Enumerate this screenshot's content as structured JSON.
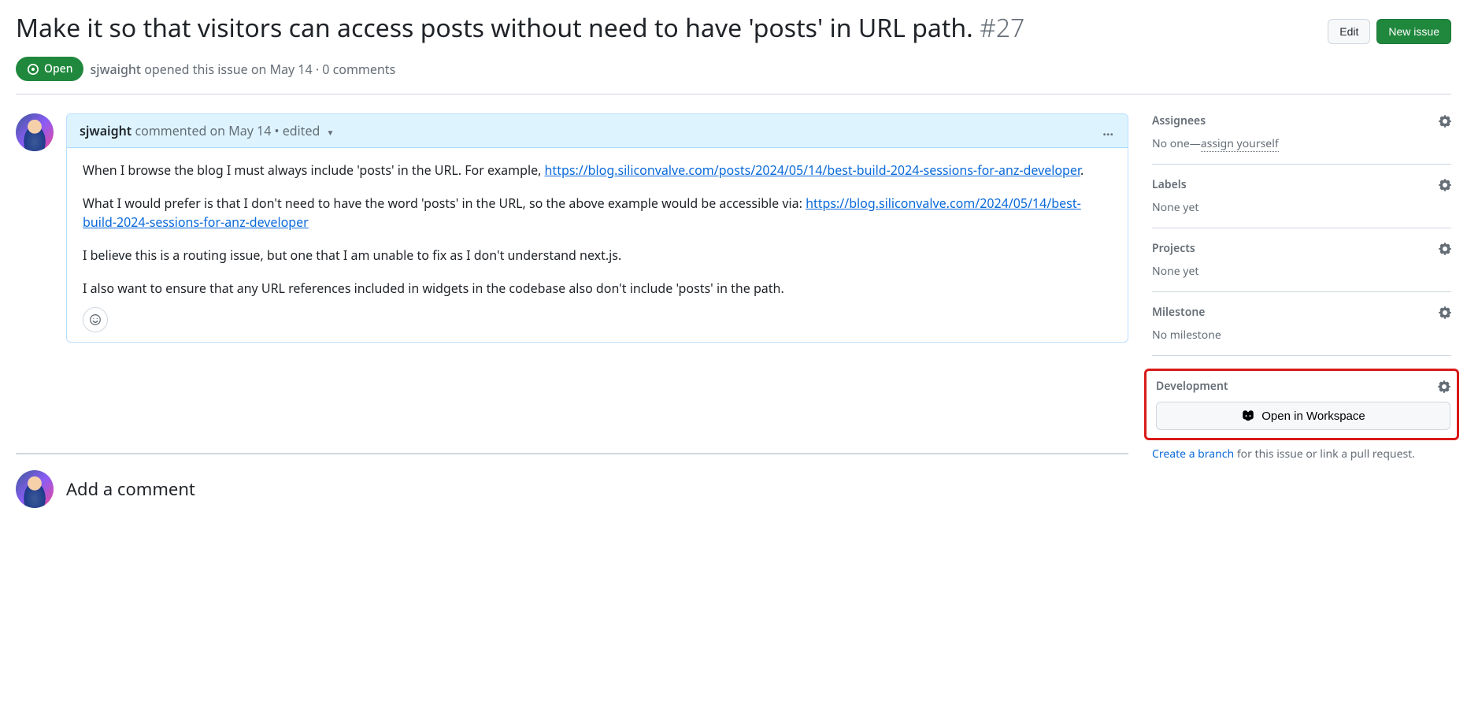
{
  "issue": {
    "title": "Make it so that visitors can access posts without need to have 'posts' in URL path.",
    "number": "#27",
    "state_label": "Open",
    "author": "sjwaight",
    "opened_text": "opened this issue",
    "opened_date": "on May 14",
    "comments_text": "0 comments"
  },
  "actions": {
    "edit": "Edit",
    "new_issue": "New issue"
  },
  "comment": {
    "author": "sjwaight",
    "verb": "commented",
    "date": "on May 14",
    "edited": "edited",
    "body": {
      "p1_pre": "When I browse the blog I must always include 'posts' in the URL. For example, ",
      "p1_link": "https://blog.siliconvalve.com/posts/2024/05/14/best-build-2024-sessions-for-anz-developer",
      "p1_post": ".",
      "p2_pre": "What I would prefer is that I don't need to have the word 'posts' in the URL, so the above example would be accessible via: ",
      "p2_link": "https://blog.siliconvalve.com/2024/05/14/best-build-2024-sessions-for-anz-developer",
      "p3": "I believe this is a routing issue, but one that I am unable to fix as I don't understand next.js.",
      "p4": "I also want to ensure that any URL references included in widgets in the codebase also don't include 'posts' in the path."
    }
  },
  "sidebar": {
    "assignees": {
      "title": "Assignees",
      "text": "No one—",
      "link": "assign yourself"
    },
    "labels": {
      "title": "Labels",
      "text": "None yet"
    },
    "projects": {
      "title": "Projects",
      "text": "None yet"
    },
    "milestone": {
      "title": "Milestone",
      "text": "No milestone"
    },
    "development": {
      "title": "Development",
      "button": "Open in Workspace",
      "footer_link": "Create a branch",
      "footer_rest": " for this issue or link a pull request."
    }
  },
  "add_comment": {
    "heading": "Add a comment"
  }
}
